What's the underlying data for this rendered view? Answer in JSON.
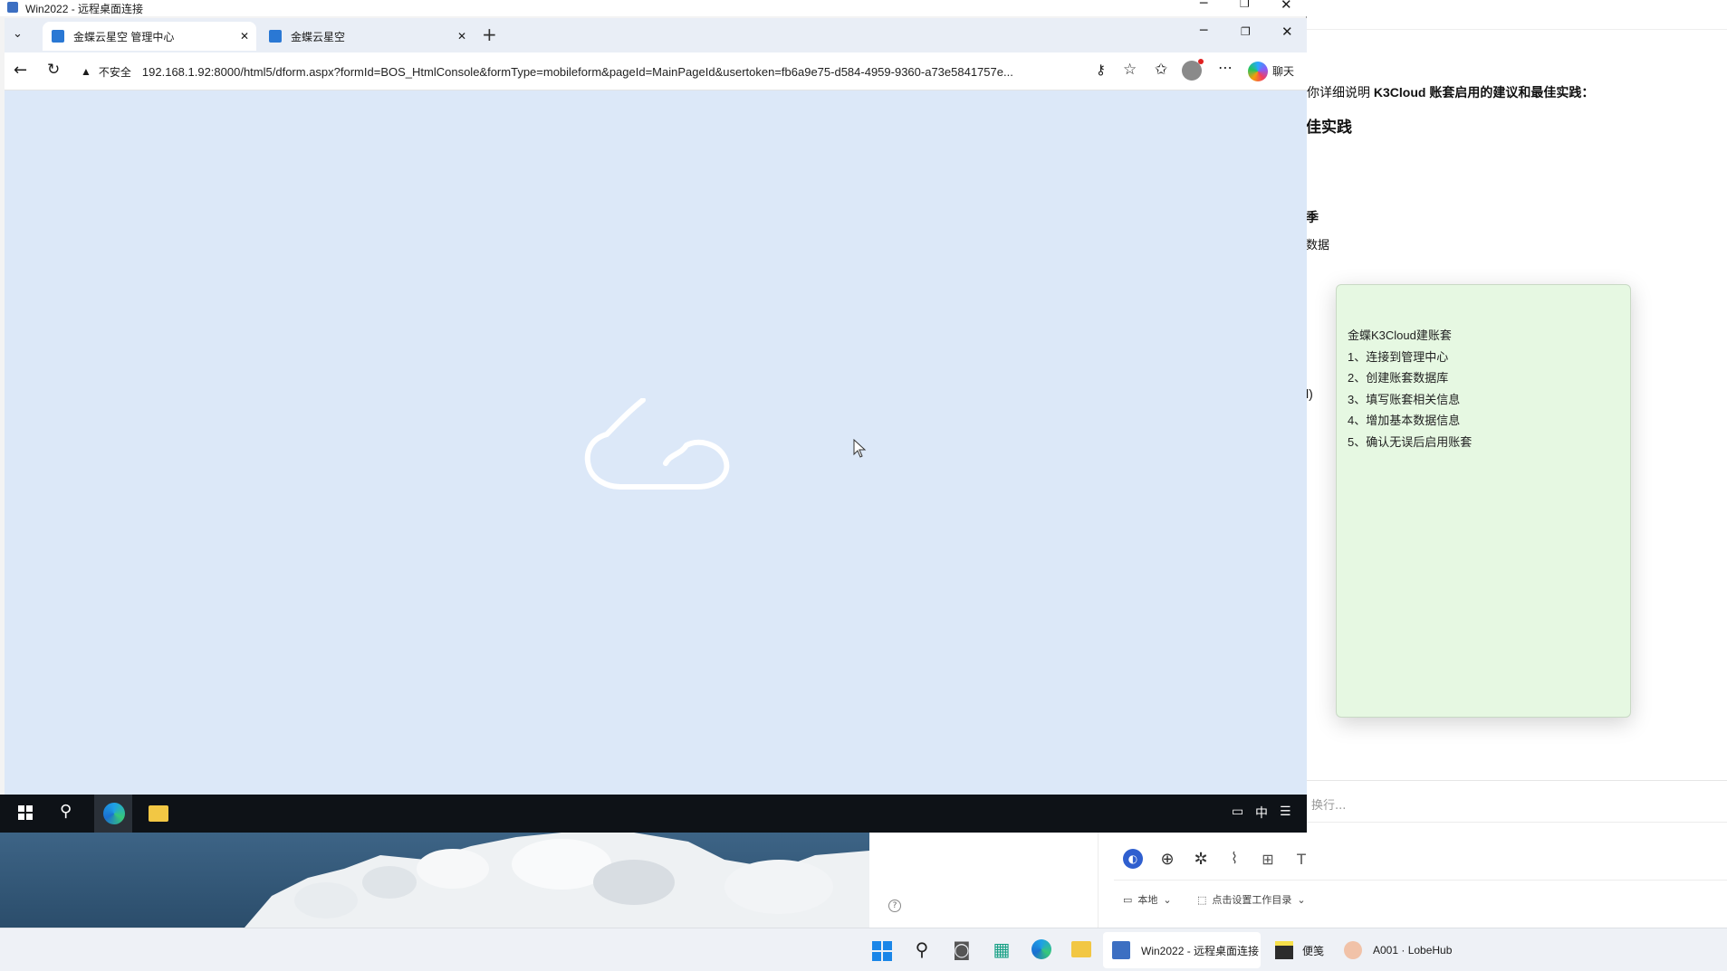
{
  "rdp": {
    "title": "Win2022 - 远程桌面连接"
  },
  "browser": {
    "tabs": [
      {
        "label": "金蝶云星空 管理中心"
      },
      {
        "label": "金蝶云星空"
      }
    ],
    "address": {
      "security_label": "不安全",
      "url": "192.168.1.92:8000/html5/dform.aspx?formId=BOS_HtmlConsole&formType=mobileform&pageId=MainPageId&usertoken=fb6a9e75-d584-4959-9360-a73e5841757e..."
    },
    "copilot_label": "聊天"
  },
  "remote_taskbar": {
    "ime": "中"
  },
  "background_app": {
    "line1_prefix": "你详细说明 ",
    "line1_bold": "K3Cloud 账套启用的建议和最佳实践：",
    "heading": "佳实践",
    "frag1": "季",
    "frag2": "数据",
    "frag3": "l)",
    "input_placeholder": "换行...",
    "local_label": "本地",
    "workdir_label": "点击设置工作目录"
  },
  "sticky_note": {
    "title": "金蝶K3Cloud建账套",
    "items": [
      "1、连接到管理中心",
      "2、创建账套数据库",
      "3、填写账套相关信息",
      "4、增加基本数据信息",
      "5、确认无误后启用账套"
    ]
  },
  "taskbar": {
    "rdp_label": "Win2022 - 远程桌面连接",
    "notes_label": "便笺",
    "lobe_label": "A001 · LobeHub"
  },
  "colors": {
    "page_bg": "#dce8f8",
    "note_bg": "#e6f8e2",
    "remote_taskbar": "#0e1217",
    "accent": "#2a78d4"
  }
}
